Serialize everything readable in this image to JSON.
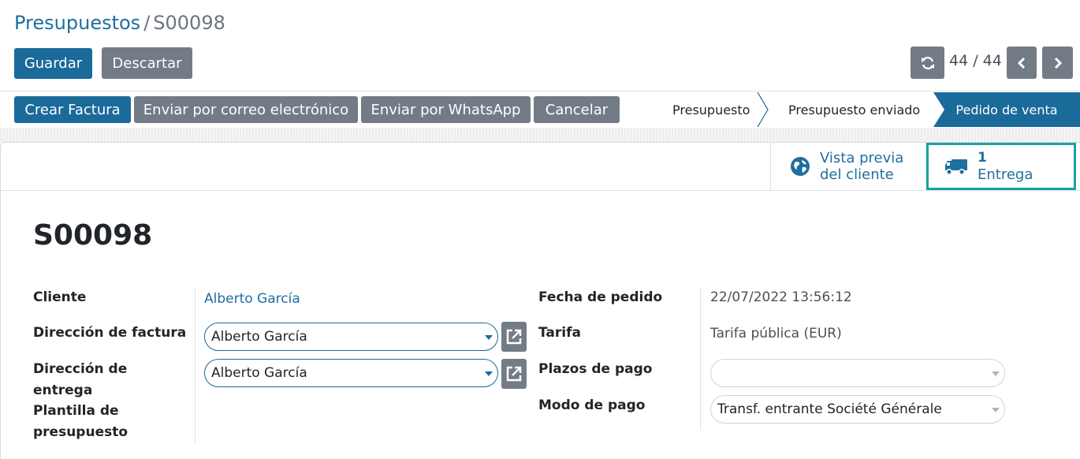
{
  "breadcrumb": {
    "parent": "Presupuestos",
    "separator": "/",
    "current": "S00098"
  },
  "toolbar": {
    "save_label": "Guardar",
    "discard_label": "Descartar"
  },
  "pager": {
    "value": "44 / 44"
  },
  "actions": {
    "create_invoice": "Crear Factura",
    "send_email": "Enviar por correo electrónico",
    "send_whatsapp": "Enviar por WhatsApp",
    "cancel": "Cancelar"
  },
  "status": {
    "stages": [
      "Presupuesto",
      "Presupuesto enviado",
      "Pedido de venta"
    ],
    "active": "Pedido de venta"
  },
  "smart_buttons": {
    "preview": {
      "line1": "Vista previa",
      "line2": "del cliente",
      "icon": "globe-icon"
    },
    "delivery": {
      "count": "1",
      "label": "Entrega",
      "icon": "truck-icon"
    }
  },
  "record": {
    "name": "S00098"
  },
  "fields": {
    "cliente": {
      "label": "Cliente",
      "value": "Alberto García"
    },
    "direccion_factura": {
      "label": "Dirección de factura",
      "value": "Alberto García"
    },
    "direccion_entrega": {
      "label_line1": "Dirección de",
      "label_line2": "entrega",
      "value": "Alberto García"
    },
    "plantilla": {
      "label_line1": "Plantilla de",
      "label_line2": "presupuesto"
    },
    "fecha_pedido": {
      "label": "Fecha de pedido",
      "value": "22/07/2022 13:56:12"
    },
    "tarifa": {
      "label": "Tarifa",
      "value": "Tarifa pública (EUR)"
    },
    "plazos_pago": {
      "label": "Plazos de pago",
      "value": ""
    },
    "modo_pago": {
      "label": "Modo de pago",
      "value": "Transf. entrante Société Générale"
    }
  },
  "colors": {
    "primary": "#1a6a9a",
    "secondary": "#737b86",
    "highlight": "#17a2a2",
    "link": "#1f6f9f"
  }
}
